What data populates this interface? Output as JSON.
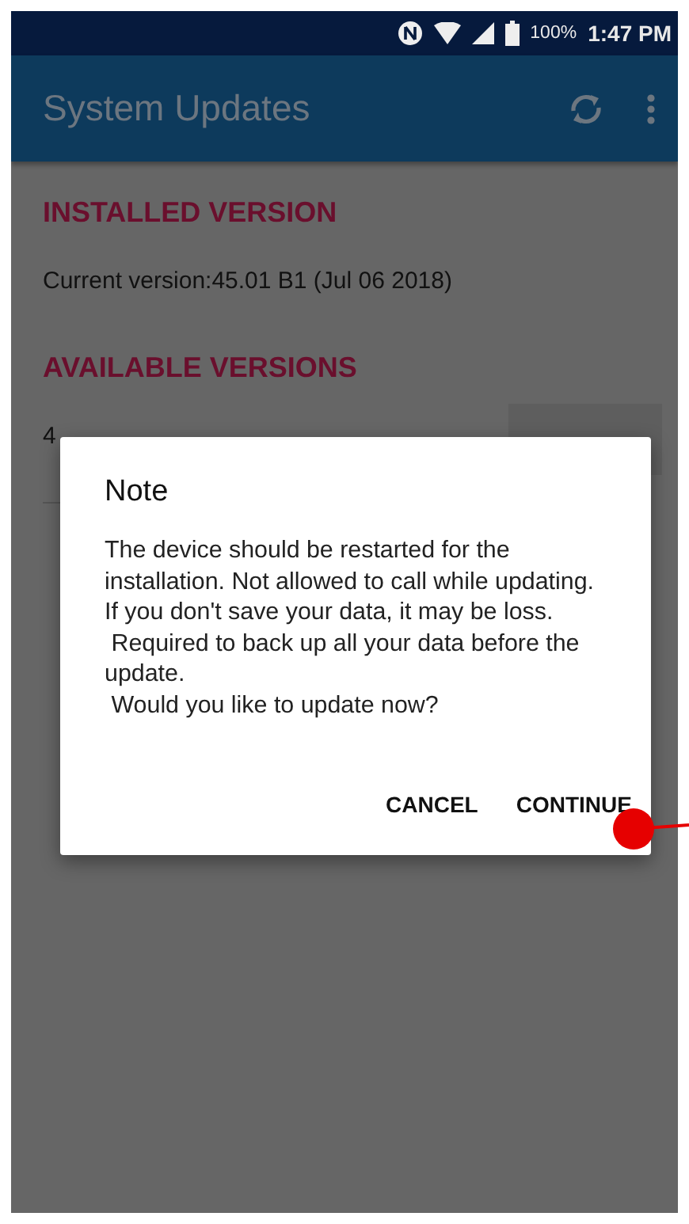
{
  "status_bar": {
    "battery": "100%",
    "time": "1:47 PM"
  },
  "app_bar": {
    "title": "System Updates"
  },
  "installed": {
    "heading": "INSTALLED VERSION",
    "current": "Current version:45.01 B1 (Jul 06 2018)"
  },
  "available": {
    "heading": "AVAILABLE VERSIONS",
    "version_partial": "4"
  },
  "dialog": {
    "title": "Note",
    "message": "The device should be restarted for the installation. Not allowed to call while updating. If you don't save your data, it may be loss.\n Required to back up all your data before the update.\n Would you like to update now?",
    "buttons": [
      "CANCEL",
      "CONTINUE"
    ]
  }
}
